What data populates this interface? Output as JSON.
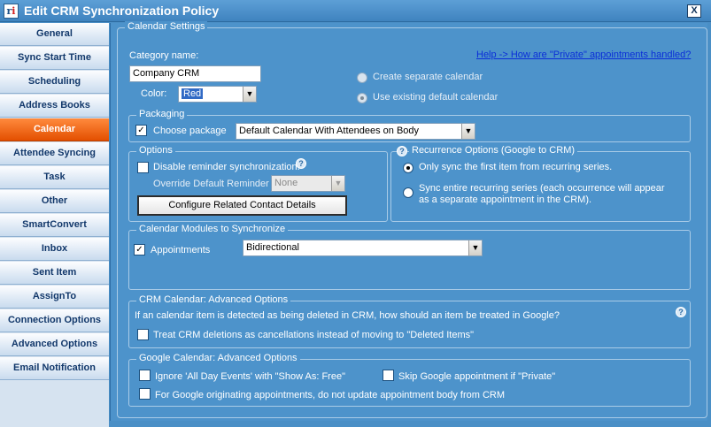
{
  "window": {
    "title": "Edit CRM Synchronization Policy",
    "close_glyph": "X",
    "logo_icon": "app-logo-icon"
  },
  "sidebar": {
    "items": [
      {
        "label": "General",
        "active": false
      },
      {
        "label": "Sync Start Time",
        "active": false
      },
      {
        "label": "Scheduling",
        "active": false
      },
      {
        "label": "Address Books",
        "active": false
      },
      {
        "label": "Calendar",
        "active": true
      },
      {
        "label": "Attendee Syncing",
        "active": false
      },
      {
        "label": "Task",
        "active": false
      },
      {
        "label": "Other",
        "active": false
      },
      {
        "label": "SmartConvert",
        "active": false
      },
      {
        "label": "Inbox",
        "active": false
      },
      {
        "label": "Sent Item",
        "active": false
      },
      {
        "label": "AssignTo",
        "active": false
      },
      {
        "label": "Connection Options",
        "active": false
      },
      {
        "label": "Advanced Options",
        "active": false
      },
      {
        "label": "Email Notification",
        "active": false
      }
    ]
  },
  "calendar_settings": {
    "legend": "Calendar Settings",
    "category_label": "Category name:",
    "category_value": "Company CRM",
    "color_label": "Color:",
    "color_value": "Red",
    "help_link": "Help -> How are \"Private\" appointments handled?",
    "radio_separate": "Create separate calendar",
    "radio_existing": "Use existing default calendar"
  },
  "packaging": {
    "legend": "Packaging",
    "choose_package_label": "Choose package",
    "choose_package_checked": true,
    "package_value": "Default Calendar With Attendees on Body"
  },
  "options": {
    "legend": "Options",
    "disable_reminder_label": "Disable reminder synchronization.",
    "disable_reminder_checked": false,
    "override_label": "Override Default Reminder",
    "override_value": "None",
    "configure_button": "Configure Related Contact Details"
  },
  "recurrence": {
    "legend": "Recurrence Options (Google to CRM)",
    "option_first": "Only sync the first item from recurring series.",
    "option_entire_line1": "Sync entire recurring series (each occurrence will appear",
    "option_entire_line2": "as a separate appointment in the CRM).",
    "selected": "first"
  },
  "modules": {
    "legend": "Calendar Modules to Synchronize",
    "appointments_label": "Appointments",
    "appointments_checked": true,
    "appointments_direction": "Bidirectional"
  },
  "crm_advanced": {
    "legend": "CRM Calendar: Advanced Options",
    "question": "If an calendar item is detected as being deleted in CRM, how should an item be treated in Google?",
    "treat_deletions_label": "Treat CRM deletions as cancellations instead of moving to \"Deleted Items\"",
    "treat_deletions_checked": false
  },
  "google_advanced": {
    "legend": "Google Calendar: Advanced Options",
    "ignore_all_day_label": "Ignore 'All Day Events' with \"Show As: Free\"",
    "skip_private_label": "Skip Google appointment if \"Private\"",
    "no_update_body_label": "For Google originating appointments, do not update appointment body from CRM"
  },
  "colors": {
    "panel_bg": "#4d93cb",
    "active_tab": "#f26a12",
    "link": "#0a2ed8"
  }
}
